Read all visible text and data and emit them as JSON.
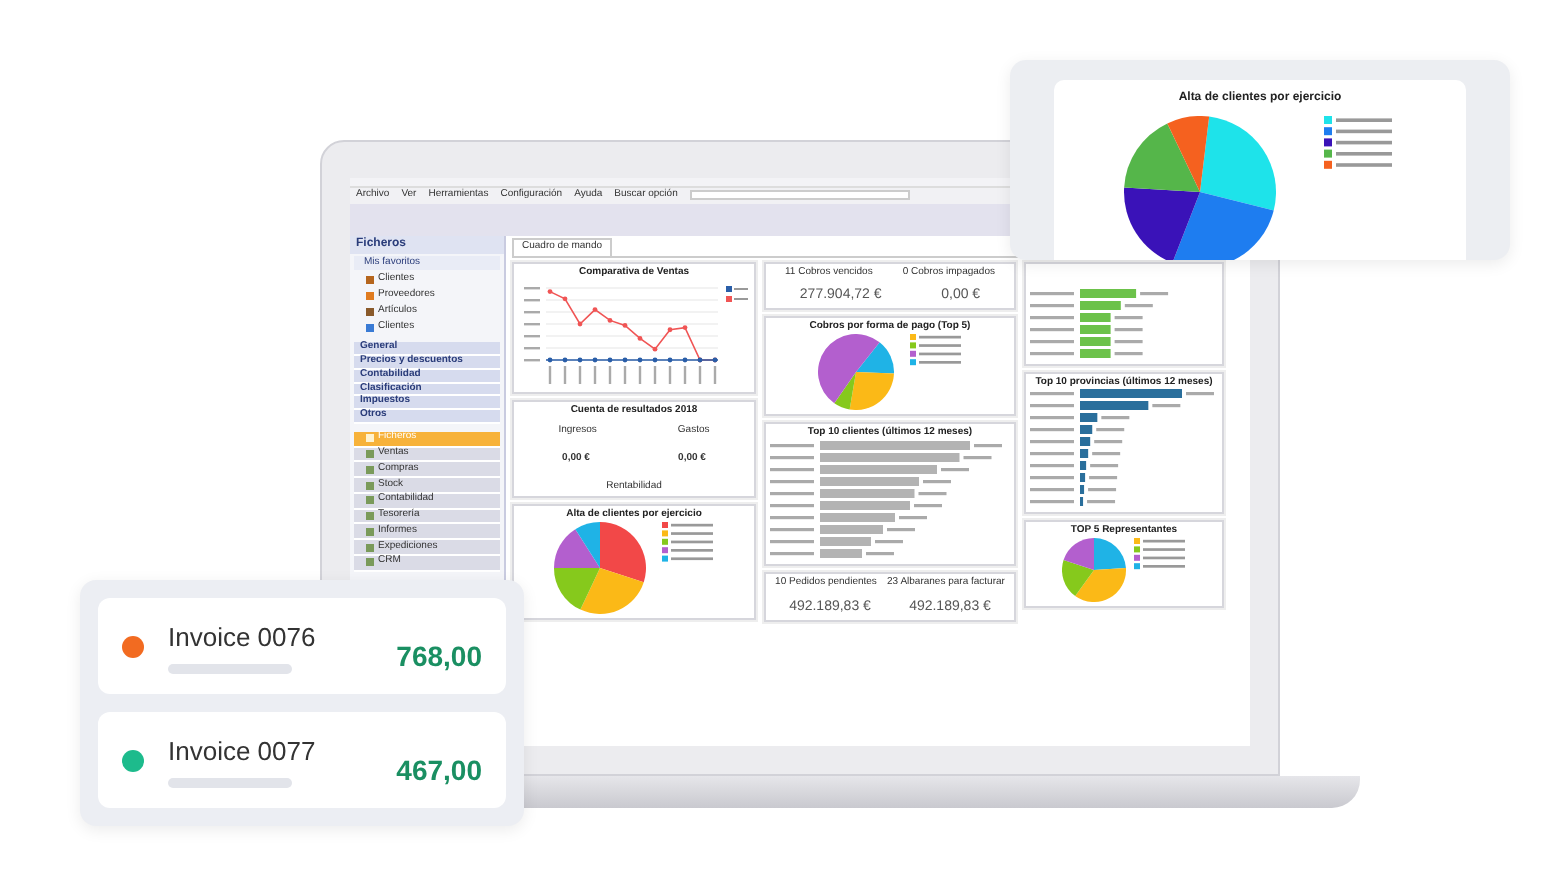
{
  "app": {
    "menu": [
      "Archivo",
      "Ver",
      "Herramientas",
      "Configuración",
      "Ayuda"
    ],
    "search_label": "Buscar opción"
  },
  "sidebar": {
    "title": "Ficheros",
    "favorites": "Mis favoritos",
    "items": [
      "Clientes",
      "Proveedores",
      "Artículos",
      "Clientes"
    ],
    "sections": [
      "General",
      "Precios y descuentos",
      "Contabilidad",
      "Clasificación",
      "Impuestos",
      "Otros"
    ],
    "modules": [
      {
        "label": "Ficheros",
        "selected": true
      },
      {
        "label": "Ventas",
        "selected": false
      },
      {
        "label": "Compras",
        "selected": false
      },
      {
        "label": "Stock",
        "selected": false
      },
      {
        "label": "Contabilidad",
        "selected": false
      },
      {
        "label": "Tesorería",
        "selected": false
      },
      {
        "label": "Informes",
        "selected": false
      },
      {
        "label": "Expediciones",
        "selected": false
      },
      {
        "label": "CRM",
        "selected": false
      }
    ]
  },
  "tab": "Cuadro de mando",
  "sales_chart": {
    "title": "Comparativa de Ventas"
  },
  "results": {
    "title": "Cuenta de resultados 2018",
    "income_label": "Ingresos",
    "expense_label": "Gastos",
    "income": "0,00 €",
    "expense": "0,00 €",
    "footer": "Rentabilidad"
  },
  "clients_chart": {
    "title": "Alta de clientes por ejercicio"
  },
  "collections": {
    "due_label": "11 Cobros vencidos",
    "unpaid_label": "0 Cobros impagados",
    "due": "277.904,72 €",
    "unpaid": "0,00 €"
  },
  "payment_chart": {
    "title": "Cobros por forma de pago (Top 5)"
  },
  "top_clients": {
    "title": "Top 10 clientes (últimos 12 meses)"
  },
  "orders": {
    "pending_label": "10 Pedidos pendientes",
    "notes_label": "23 Albaranes para facturar",
    "pending": "492.189,83 €",
    "notes": "492.189,83 €"
  },
  "provinces": {
    "title": "Top 10 provincias (últimos 12 meses)"
  },
  "reps": {
    "title": "TOP 5 Representantes"
  },
  "popup": {
    "title": "Alta de clientes por ejercicio"
  },
  "invoices": [
    {
      "title": "Invoice 0076",
      "amount": "768,00",
      "color": "#f26b21"
    },
    {
      "title": "Invoice 0077",
      "amount": "467,00",
      "color": "#1dbb8c"
    }
  ]
}
